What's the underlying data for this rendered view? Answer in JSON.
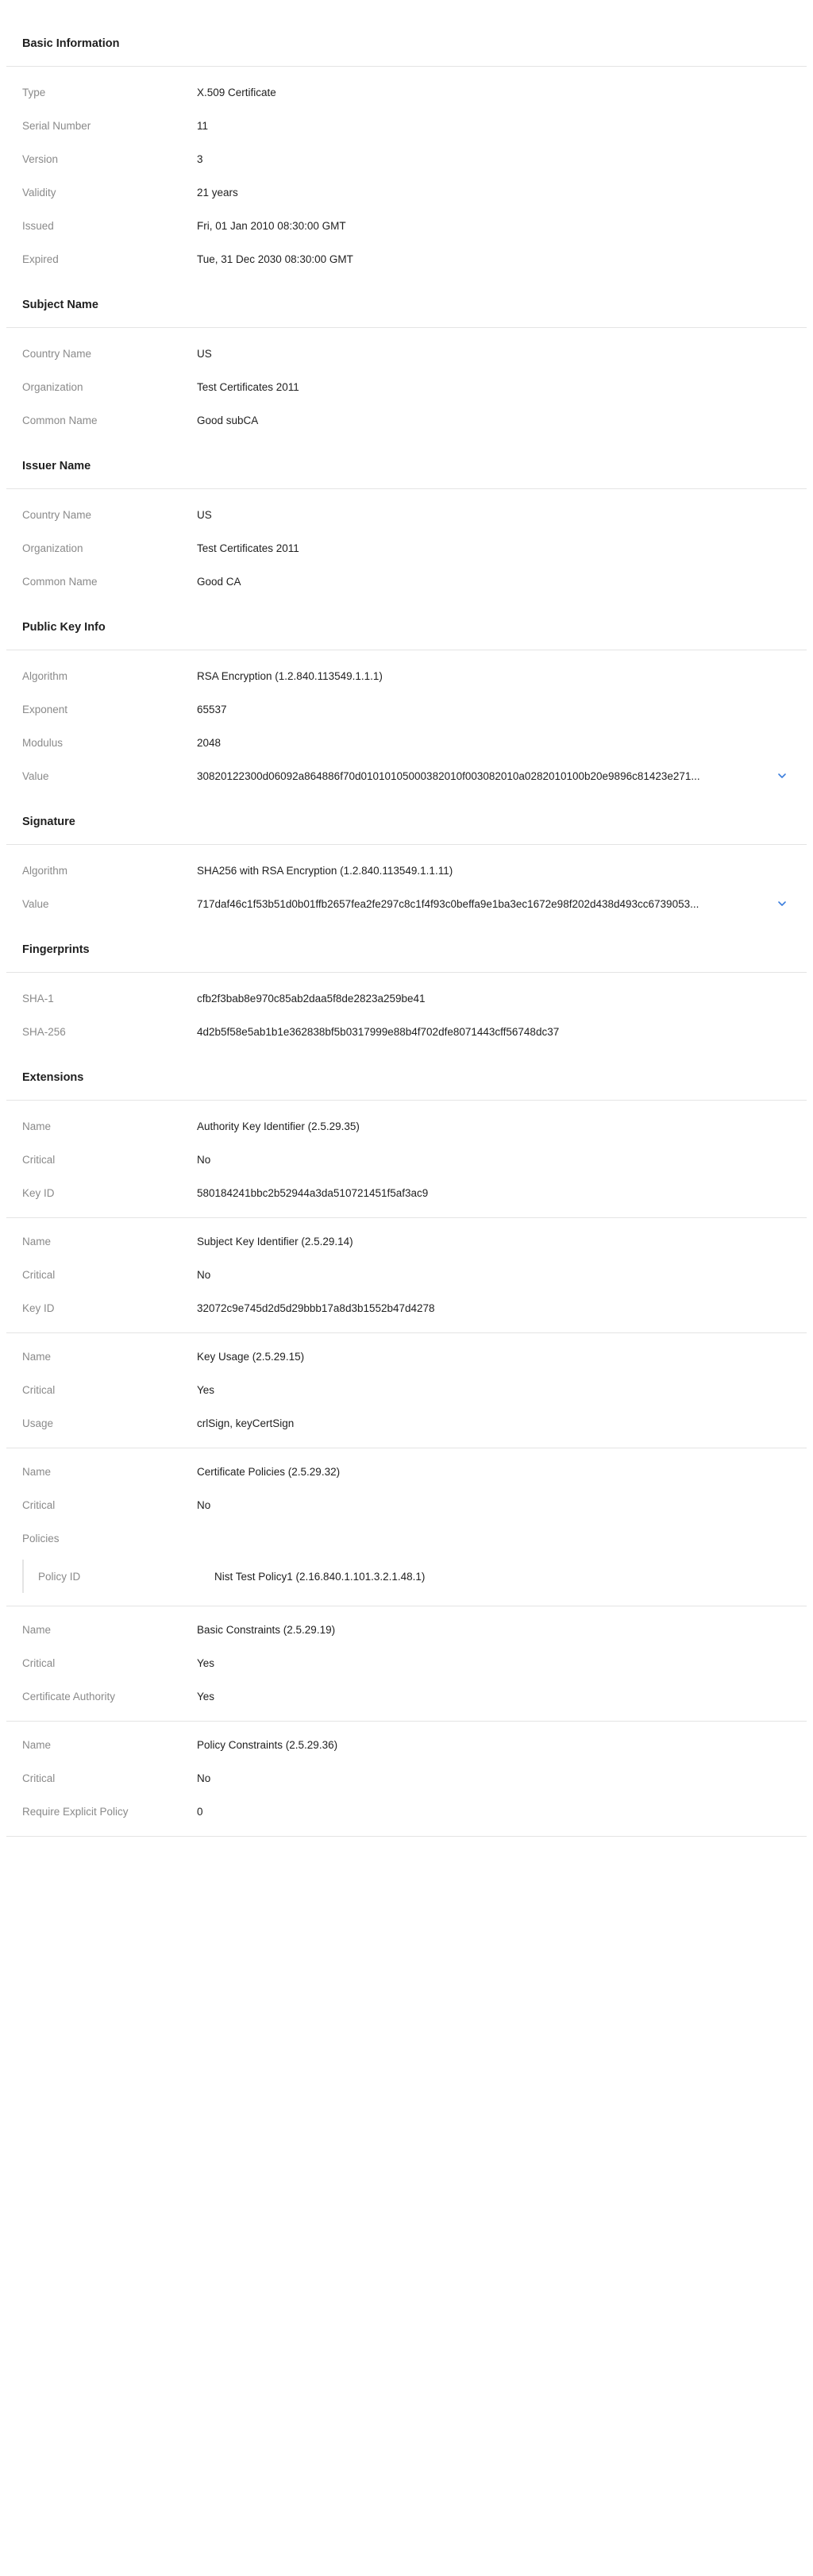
{
  "sections": {
    "basic": {
      "title": "Basic Information",
      "type_label": "Type",
      "type_value": "X.509 Certificate",
      "serial_label": "Serial Number",
      "serial_value": "11",
      "version_label": "Version",
      "version_value": "3",
      "validity_label": "Validity",
      "validity_value": "21 years",
      "issued_label": "Issued",
      "issued_value": "Fri, 01 Jan 2010 08:30:00 GMT",
      "expired_label": "Expired",
      "expired_value": "Tue, 31 Dec 2030 08:30:00 GMT"
    },
    "subject": {
      "title": "Subject Name",
      "country_label": "Country Name",
      "country_value": "US",
      "org_label": "Organization",
      "org_value": "Test Certificates 2011",
      "cn_label": "Common Name",
      "cn_value": "Good subCA"
    },
    "issuer": {
      "title": "Issuer Name",
      "country_label": "Country Name",
      "country_value": "US",
      "org_label": "Organization",
      "org_value": "Test Certificates 2011",
      "cn_label": "Common Name",
      "cn_value": "Good CA"
    },
    "pubkey": {
      "title": "Public Key Info",
      "alg_label": "Algorithm",
      "alg_value": "RSA Encryption (1.2.840.113549.1.1.1)",
      "exp_label": "Exponent",
      "exp_value": "65537",
      "mod_label": "Modulus",
      "mod_value": "2048",
      "val_label": "Value",
      "val_value": "30820122300d06092a864886f70d01010105000382010f003082010a0282010100b20e9896c81423e271..."
    },
    "signature": {
      "title": "Signature",
      "alg_label": "Algorithm",
      "alg_value": "SHA256 with RSA Encryption (1.2.840.113549.1.1.11)",
      "val_label": "Value",
      "val_value": "717daf46c1f53b51d0b01ffb2657fea2fe297c8c1f4f93c0beffa9e1ba3ec1672e98f202d438d493cc6739053..."
    },
    "fingerprints": {
      "title": "Fingerprints",
      "sha1_label": "SHA-1",
      "sha1_value": "cfb2f3bab8e970c85ab2daa5f8de2823a259be41",
      "sha256_label": "SHA-256",
      "sha256_value": "4d2b5f58e5ab1b1e362838bf5b0317999e88b4f702dfe8071443cff56748dc37"
    },
    "extensions": {
      "title": "Extensions",
      "aki": {
        "name_label": "Name",
        "name_value": "Authority Key Identifier (2.5.29.35)",
        "critical_label": "Critical",
        "critical_value": "No",
        "keyid_label": "Key ID",
        "keyid_value": "580184241bbc2b52944a3da510721451f5af3ac9"
      },
      "ski": {
        "name_label": "Name",
        "name_value": "Subject Key Identifier (2.5.29.14)",
        "critical_label": "Critical",
        "critical_value": "No",
        "keyid_label": "Key ID",
        "keyid_value": "32072c9e745d2d5d29bbb17a8d3b1552b47d4278"
      },
      "ku": {
        "name_label": "Name",
        "name_value": "Key Usage (2.5.29.15)",
        "critical_label": "Critical",
        "critical_value": "Yes",
        "usage_label": "Usage",
        "usage_value": "crlSign, keyCertSign"
      },
      "cp": {
        "name_label": "Name",
        "name_value": "Certificate Policies (2.5.29.32)",
        "critical_label": "Critical",
        "critical_value": "No",
        "policies_label": "Policies",
        "policy_id_label": "Policy ID",
        "policy_id_value": "Nist Test Policy1 (2.16.840.1.101.3.2.1.48.1)"
      },
      "bc": {
        "name_label": "Name",
        "name_value": "Basic Constraints (2.5.29.19)",
        "critical_label": "Critical",
        "critical_value": "Yes",
        "ca_label": "Certificate Authority",
        "ca_value": "Yes"
      },
      "pc": {
        "name_label": "Name",
        "name_value": "Policy Constraints (2.5.29.36)",
        "critical_label": "Critical",
        "critical_value": "No",
        "rep_label": "Require Explicit Policy",
        "rep_value": "0"
      }
    }
  },
  "icons": {
    "expand": "chevron-down-icon"
  },
  "colors": {
    "accent": "#3b7ddd",
    "label": "#8a8a8a",
    "divider": "#e4e4e4"
  }
}
